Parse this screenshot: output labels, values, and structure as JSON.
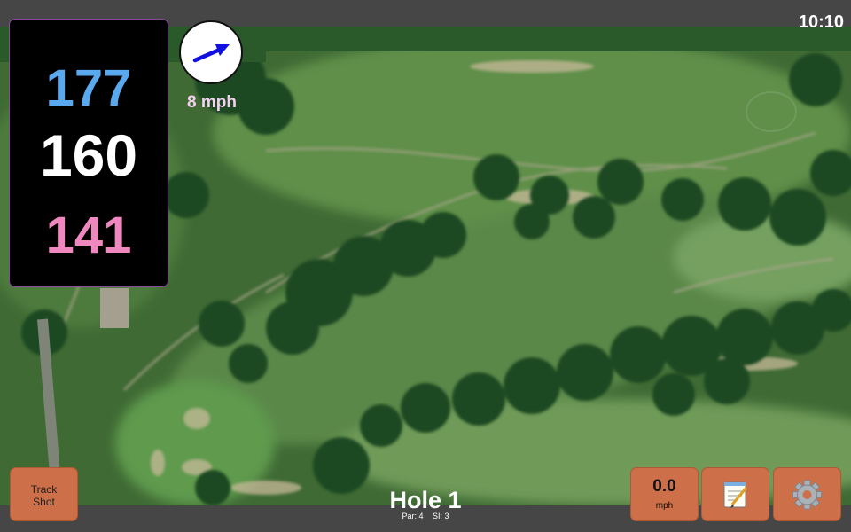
{
  "status_bar": {
    "time": "10:10"
  },
  "distances": {
    "back": "177",
    "middle": "160",
    "front": "141"
  },
  "wind": {
    "speed_label": "8 mph",
    "direction_icon": "wind-arrow-icon"
  },
  "buttons": {
    "track_shot": [
      "Track",
      "Shot"
    ],
    "speed_value": "0.0",
    "speed_unit": "mph",
    "notes_icon": "notepad-icon",
    "settings_icon": "gear-icon"
  },
  "hole": {
    "title": "Hole 1",
    "par": "Par: 4",
    "si": "SI: 3"
  },
  "colors": {
    "back": "#5aa8ee",
    "middle": "#ffffff",
    "front": "#f088c0",
    "button": "#cd6f48"
  }
}
